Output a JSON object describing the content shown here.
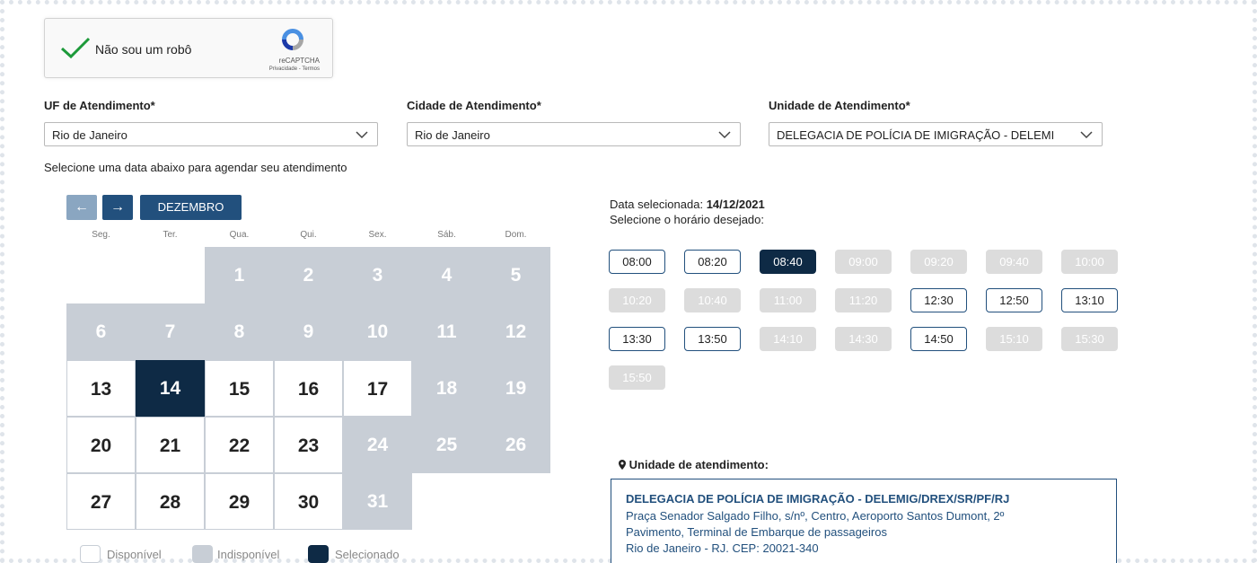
{
  "recaptcha": {
    "label": "Não sou um robô",
    "brand": "reCAPTCHA",
    "links": "Privacidade - Termos"
  },
  "fields": {
    "uf": {
      "label": "UF de Atendimento*",
      "value": "Rio de Janeiro"
    },
    "cidade": {
      "label": "Cidade de Atendimento*",
      "value": "Rio de Janeiro"
    },
    "unidade": {
      "label": "Unidade de Atendimento*",
      "value": "DELEGACIA DE POLÍCIA DE IMIGRAÇÃO - DELEMI"
    }
  },
  "instruction": "Selecione uma data abaixo para agendar seu atendimento",
  "calendar": {
    "prev_icon": "←",
    "next_icon": "→",
    "month": "DEZEMBRO",
    "weekdays": [
      "Seg.",
      "Ter.",
      "Qua.",
      "Qui.",
      "Sex.",
      "Sáb.",
      "Dom."
    ],
    "days": [
      {
        "d": "1",
        "status": "unavailable"
      },
      {
        "d": "2",
        "status": "unavailable"
      },
      {
        "d": "3",
        "status": "unavailable"
      },
      {
        "d": "4",
        "status": "unavailable"
      },
      {
        "d": "5",
        "status": "unavailable"
      },
      {
        "d": "6",
        "status": "unavailable"
      },
      {
        "d": "7",
        "status": "unavailable"
      },
      {
        "d": "8",
        "status": "unavailable"
      },
      {
        "d": "9",
        "status": "unavailable"
      },
      {
        "d": "10",
        "status": "unavailable"
      },
      {
        "d": "11",
        "status": "unavailable"
      },
      {
        "d": "12",
        "status": "unavailable"
      },
      {
        "d": "13",
        "status": "available"
      },
      {
        "d": "14",
        "status": "selected"
      },
      {
        "d": "15",
        "status": "available"
      },
      {
        "d": "16",
        "status": "available"
      },
      {
        "d": "17",
        "status": "available"
      },
      {
        "d": "18",
        "status": "unavailable"
      },
      {
        "d": "19",
        "status": "unavailable"
      },
      {
        "d": "20",
        "status": "available"
      },
      {
        "d": "21",
        "status": "available"
      },
      {
        "d": "22",
        "status": "available"
      },
      {
        "d": "23",
        "status": "available"
      },
      {
        "d": "24",
        "status": "unavailable"
      },
      {
        "d": "25",
        "status": "unavailable"
      },
      {
        "d": "26",
        "status": "unavailable"
      },
      {
        "d": "27",
        "status": "available"
      },
      {
        "d": "28",
        "status": "available"
      },
      {
        "d": "29",
        "status": "available"
      },
      {
        "d": "30",
        "status": "available"
      },
      {
        "d": "31",
        "status": "unavailable"
      }
    ],
    "legend": {
      "available": "Disponível",
      "unavailable": "Indisponível",
      "selected": "Selecionado"
    }
  },
  "schedule": {
    "selected_date_label": "Data selecionada:",
    "selected_date": "14/12/2021",
    "choose_time": "Selecione o horário desejado:",
    "times": [
      {
        "t": "08:00",
        "status": "available"
      },
      {
        "t": "08:20",
        "status": "available"
      },
      {
        "t": "08:40",
        "status": "selected"
      },
      {
        "t": "09:00",
        "status": "unavailable"
      },
      {
        "t": "09:20",
        "status": "unavailable"
      },
      {
        "t": "09:40",
        "status": "unavailable"
      },
      {
        "t": "10:00",
        "status": "unavailable"
      },
      {
        "t": "10:20",
        "status": "unavailable"
      },
      {
        "t": "10:40",
        "status": "unavailable"
      },
      {
        "t": "11:00",
        "status": "unavailable"
      },
      {
        "t": "11:20",
        "status": "unavailable"
      },
      {
        "t": "12:30",
        "status": "available"
      },
      {
        "t": "12:50",
        "status": "available"
      },
      {
        "t": "13:10",
        "status": "available"
      },
      {
        "t": "13:30",
        "status": "available"
      },
      {
        "t": "13:50",
        "status": "available"
      },
      {
        "t": "14:10",
        "status": "unavailable"
      },
      {
        "t": "14:30",
        "status": "unavailable"
      },
      {
        "t": "14:50",
        "status": "available"
      },
      {
        "t": "15:10",
        "status": "unavailable"
      },
      {
        "t": "15:30",
        "status": "unavailable"
      },
      {
        "t": "15:50",
        "status": "unavailable"
      }
    ]
  },
  "unit": {
    "title": "Unidade de atendimento:",
    "name": "DELEGACIA DE POLÍCIA DE IMIGRAÇÃO - DELEMIG/DREX/SR/PF/RJ",
    "address_1": "Praça Senador Salgado Filho, s/nº, Centro, Aeroporto Santos Dumont, 2º",
    "address_2": "Pavimento, Terminal de Embarque de passageiros",
    "address_3": "Rio de Janeiro - RJ. CEP: 20021-340"
  },
  "colors": {
    "primary": "#22507d",
    "selected": "#0e2a45",
    "unavailable_day": "#c8ced6",
    "unavailable_time": "#dcdcdc"
  }
}
